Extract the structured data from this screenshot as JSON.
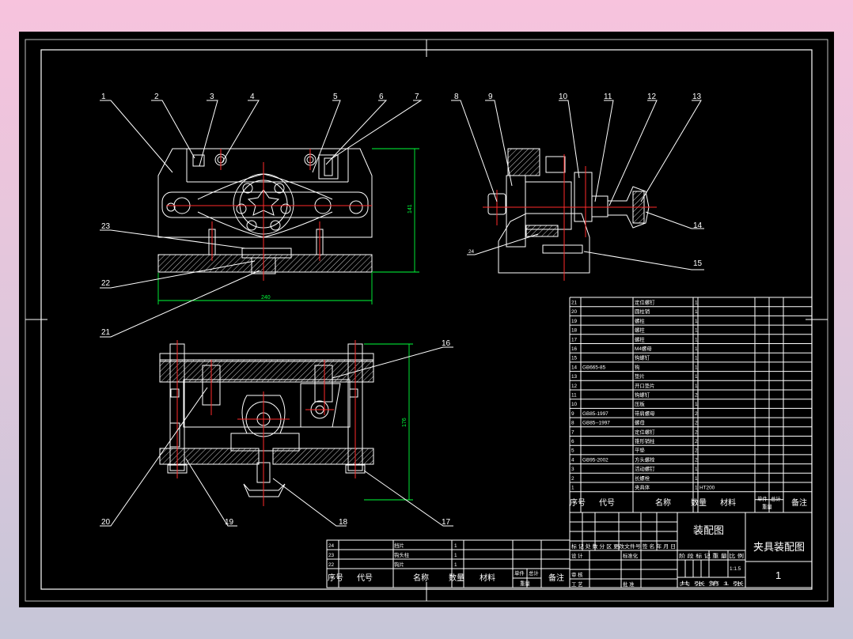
{
  "colors": {
    "background": "#000000",
    "line": "#ffffff",
    "center_line": "#ff2a2a",
    "dimension": "#00ff3a"
  },
  "balloons": {
    "p1": "1",
    "p2": "2",
    "p3": "3",
    "p4": "4",
    "p5": "5",
    "p6": "6",
    "p7": "7",
    "p8": "8",
    "p9": "9",
    "p10": "10",
    "p11": "11",
    "p12": "12",
    "p13": "13",
    "p14": "14",
    "p15": "15",
    "p16": "16",
    "p17": "17",
    "p18": "18",
    "p19": "19",
    "p20": "20",
    "p21": "21",
    "p22": "22",
    "p23": "23",
    "p24": "24"
  },
  "dimensions": {
    "front_width": "240",
    "front_height": "141",
    "top_height": "176"
  },
  "bom": {
    "rows": [
      {
        "no": "21",
        "code": "",
        "name": "定位螺钉",
        "qty": "1",
        "mat": ""
      },
      {
        "no": "20",
        "code": "",
        "name": "圆柱销",
        "qty": "1",
        "mat": ""
      },
      {
        "no": "19",
        "code": "",
        "name": "螺柱",
        "qty": "1",
        "mat": ""
      },
      {
        "no": "18",
        "code": "",
        "name": "螺柱",
        "qty": "1",
        "mat": ""
      },
      {
        "no": "17",
        "code": "",
        "name": "螺柱",
        "qty": "1",
        "mat": ""
      },
      {
        "no": "16",
        "code": "",
        "name": "M4螺母",
        "qty": "1",
        "mat": ""
      },
      {
        "no": "15",
        "code": "",
        "name": "钩螺钉",
        "qty": "1",
        "mat": ""
      },
      {
        "no": "14",
        "code": "GB665-85",
        "name": "钩",
        "qty": "1",
        "mat": ""
      },
      {
        "no": "13",
        "code": "",
        "name": "垫片",
        "qty": "1",
        "mat": ""
      },
      {
        "no": "12",
        "code": "",
        "name": "开口垫片",
        "qty": "1",
        "mat": ""
      },
      {
        "no": "11",
        "code": "",
        "name": "钩螺钉",
        "qty": "2",
        "mat": ""
      },
      {
        "no": "10",
        "code": "",
        "name": "压板",
        "qty": "1",
        "mat": ""
      },
      {
        "no": "9",
        "code": "GB85-1997",
        "name": "带肩螺母",
        "qty": "2",
        "mat": ""
      },
      {
        "no": "8",
        "code": "GB85--1997",
        "name": "螺母",
        "qty": "2",
        "mat": ""
      },
      {
        "no": "7",
        "code": "",
        "name": "定位螺钉",
        "qty": "2",
        "mat": ""
      },
      {
        "no": "6",
        "code": "",
        "name": "锥形销柱",
        "qty": "2",
        "mat": ""
      },
      {
        "no": "5",
        "code": "",
        "name": "平垫",
        "qty": "2",
        "mat": ""
      },
      {
        "no": "4",
        "code": "GB95-2002",
        "name": "方头螺栓",
        "qty": "2",
        "mat": ""
      },
      {
        "no": "3",
        "code": "",
        "name": "活动螺钉",
        "qty": "1",
        "mat": ""
      },
      {
        "no": "2",
        "code": "",
        "name": "长螺栓",
        "qty": "1",
        "mat": ""
      },
      {
        "no": "1",
        "code": "",
        "name": "夹具体",
        "qty": "1",
        "mat": "HT200"
      }
    ],
    "header": {
      "no": "序号",
      "code": "代号",
      "name": "名称",
      "qty": "数量",
      "mat": "材料",
      "single": "单件",
      "total": "总计",
      "weight": "重量",
      "remark": "备注"
    }
  },
  "lower_bom": {
    "rows": [
      {
        "no": "24",
        "name": "挡片",
        "qty": "1"
      },
      {
        "no": "23",
        "name": "钩头柱",
        "qty": "1"
      },
      {
        "no": "22",
        "name": "钩片",
        "qty": "1"
      }
    ]
  },
  "title_block": {
    "drawing_type": "装配图",
    "drawing_name": "夹具装配图",
    "sheet_no": "1",
    "scale": "1:1.5",
    "mark_row": "标 记 处 数  分 区  更改文件号  签 名  年 月 日",
    "design": "设 计",
    "standard": "标准化",
    "review": "审 核",
    "process": "工 艺",
    "approve": "批 准",
    "stage": "阶 段 标 记   重 量   比 例",
    "sheets": "共  张  第  1  张"
  }
}
